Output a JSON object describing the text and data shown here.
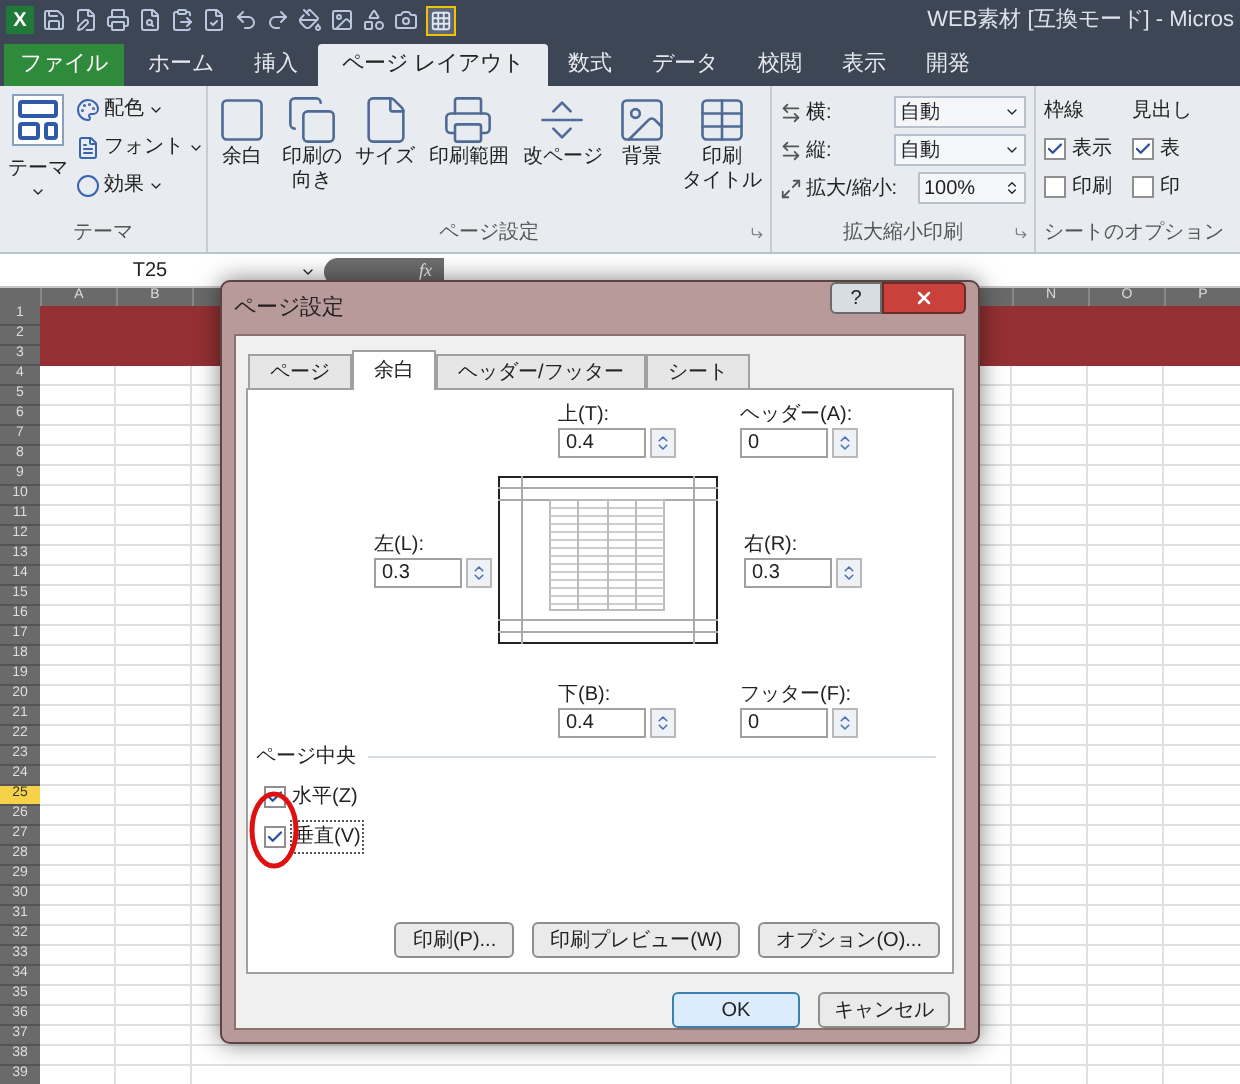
{
  "window": {
    "app_logo": "X",
    "title": "WEB素材 [互換モード] - Micros"
  },
  "ribbon_tabs": [
    {
      "label": "ファイル",
      "kind": "file",
      "selected": false
    },
    {
      "label": "ホーム",
      "kind": "tab",
      "selected": false
    },
    {
      "label": "挿入",
      "kind": "tab",
      "selected": false
    },
    {
      "label": "ページ レイアウト",
      "kind": "tab",
      "selected": true
    },
    {
      "label": "数式",
      "kind": "tab",
      "selected": false
    },
    {
      "label": "データ",
      "kind": "tab",
      "selected": false
    },
    {
      "label": "校閲",
      "kind": "tab",
      "selected": false
    },
    {
      "label": "表示",
      "kind": "tab",
      "selected": false
    },
    {
      "label": "開発",
      "kind": "tab",
      "selected": false
    }
  ],
  "theme_group": {
    "label": "テーマ",
    "big_button": "テーマ",
    "items": [
      {
        "label": "配色",
        "kind": "colors"
      },
      {
        "label": "フォント",
        "kind": "fonts"
      },
      {
        "label": "効果",
        "kind": "effects"
      }
    ]
  },
  "page_setup_group": {
    "label": "ページ設定",
    "buttons": [
      {
        "lines": [
          "余白"
        ],
        "kind": "margins"
      },
      {
        "lines": [
          "印刷の",
          "向き"
        ],
        "kind": "orientation"
      },
      {
        "lines": [
          "サイズ"
        ],
        "kind": "size"
      },
      {
        "lines": [
          "印刷範囲"
        ],
        "kind": "print_area"
      },
      {
        "lines": [
          "改ページ"
        ],
        "kind": "breaks"
      },
      {
        "lines": [
          "背景"
        ],
        "kind": "background"
      },
      {
        "lines": [
          "印刷",
          "タイトル"
        ],
        "kind": "print_titles"
      }
    ]
  },
  "scale_group": {
    "label": "拡大縮小印刷",
    "rows": [
      {
        "label": "横:",
        "value": "自動",
        "kind": "dropdown"
      },
      {
        "label": "縦:",
        "value": "自動",
        "kind": "dropdown"
      },
      {
        "label": "拡大/縮小:",
        "value": "100%",
        "kind": "spinner"
      }
    ]
  },
  "sheet_options": {
    "label": "シートのオプション",
    "columns": [
      {
        "title": "枠線",
        "options": [
          {
            "label": "表示",
            "checked": true
          },
          {
            "label": "印刷",
            "checked": false
          }
        ]
      },
      {
        "title": "見出し",
        "options": [
          {
            "label": "表",
            "checked": true
          },
          {
            "label": "印",
            "checked": false
          }
        ]
      }
    ]
  },
  "formula_bar": {
    "name_box": "T25",
    "function_label": "fx"
  },
  "sheet": {
    "columns_left": [
      "A",
      "B"
    ],
    "columns_right": [
      "N",
      "O",
      "P"
    ],
    "rows": [
      {
        "label": "1",
        "selected": false
      },
      {
        "label": "2",
        "selected": false
      },
      {
        "label": "3",
        "selected": false
      },
      {
        "label": "4",
        "selected": false
      },
      {
        "label": "5",
        "selected": false
      },
      {
        "label": "6",
        "selected": false
      },
      {
        "label": "7",
        "selected": false
      },
      {
        "label": "8",
        "selected": false
      },
      {
        "label": "9",
        "selected": false
      },
      {
        "label": "10",
        "selected": false
      },
      {
        "label": "11",
        "selected": false
      },
      {
        "label": "12",
        "selected": false
      },
      {
        "label": "13",
        "selected": false
      },
      {
        "label": "14",
        "selected": false
      },
      {
        "label": "15",
        "selected": false
      },
      {
        "label": "16",
        "selected": false
      },
      {
        "label": "17",
        "selected": false
      },
      {
        "label": "18",
        "selected": false
      },
      {
        "label": "19",
        "selected": false
      },
      {
        "label": "20",
        "selected": false
      },
      {
        "label": "21",
        "selected": false
      },
      {
        "label": "22",
        "selected": false
      },
      {
        "label": "23",
        "selected": false
      },
      {
        "label": "24",
        "selected": false
      },
      {
        "label": "25",
        "selected": true
      },
      {
        "label": "26",
        "selected": false
      },
      {
        "label": "27",
        "selected": false
      },
      {
        "label": "28",
        "selected": false
      },
      {
        "label": "29",
        "selected": false
      },
      {
        "label": "30",
        "selected": false
      },
      {
        "label": "31",
        "selected": false
      },
      {
        "label": "32",
        "selected": false
      },
      {
        "label": "33",
        "selected": false
      },
      {
        "label": "34",
        "selected": false
      },
      {
        "label": "35",
        "selected": false
      },
      {
        "label": "36",
        "selected": false
      },
      {
        "label": "37",
        "selected": false
      },
      {
        "label": "38",
        "selected": false
      },
      {
        "label": "39",
        "selected": false
      }
    ]
  },
  "dialog": {
    "title": "ページ設定",
    "help": "?",
    "tabs": [
      {
        "label": "ページ",
        "selected": false
      },
      {
        "label": "余白",
        "selected": true
      },
      {
        "label": "ヘッダー/フッター",
        "selected": false
      },
      {
        "label": "シート",
        "selected": false
      }
    ],
    "top": {
      "label": "上(T):",
      "value": "0.4"
    },
    "header": {
      "label": "ヘッダー(A):",
      "value": "0"
    },
    "left": {
      "label": "左(L):",
      "value": "0.3"
    },
    "right": {
      "label": "右(R):",
      "value": "0.3"
    },
    "bottom": {
      "label": "下(B):",
      "value": "0.4"
    },
    "footer": {
      "label": "フッター(F):",
      "value": "0"
    },
    "center_group": {
      "label": "ページ中央",
      "options": [
        {
          "label": "水平(Z)",
          "checked": true
        },
        {
          "label": "垂直(V)",
          "checked": true
        }
      ]
    },
    "buttons": [
      {
        "label": "印刷(P)..."
      },
      {
        "label": "印刷プレビュー(W)"
      },
      {
        "label": "オプション(O)..."
      }
    ],
    "ok": "OK",
    "cancel": "キャンセル"
  }
}
